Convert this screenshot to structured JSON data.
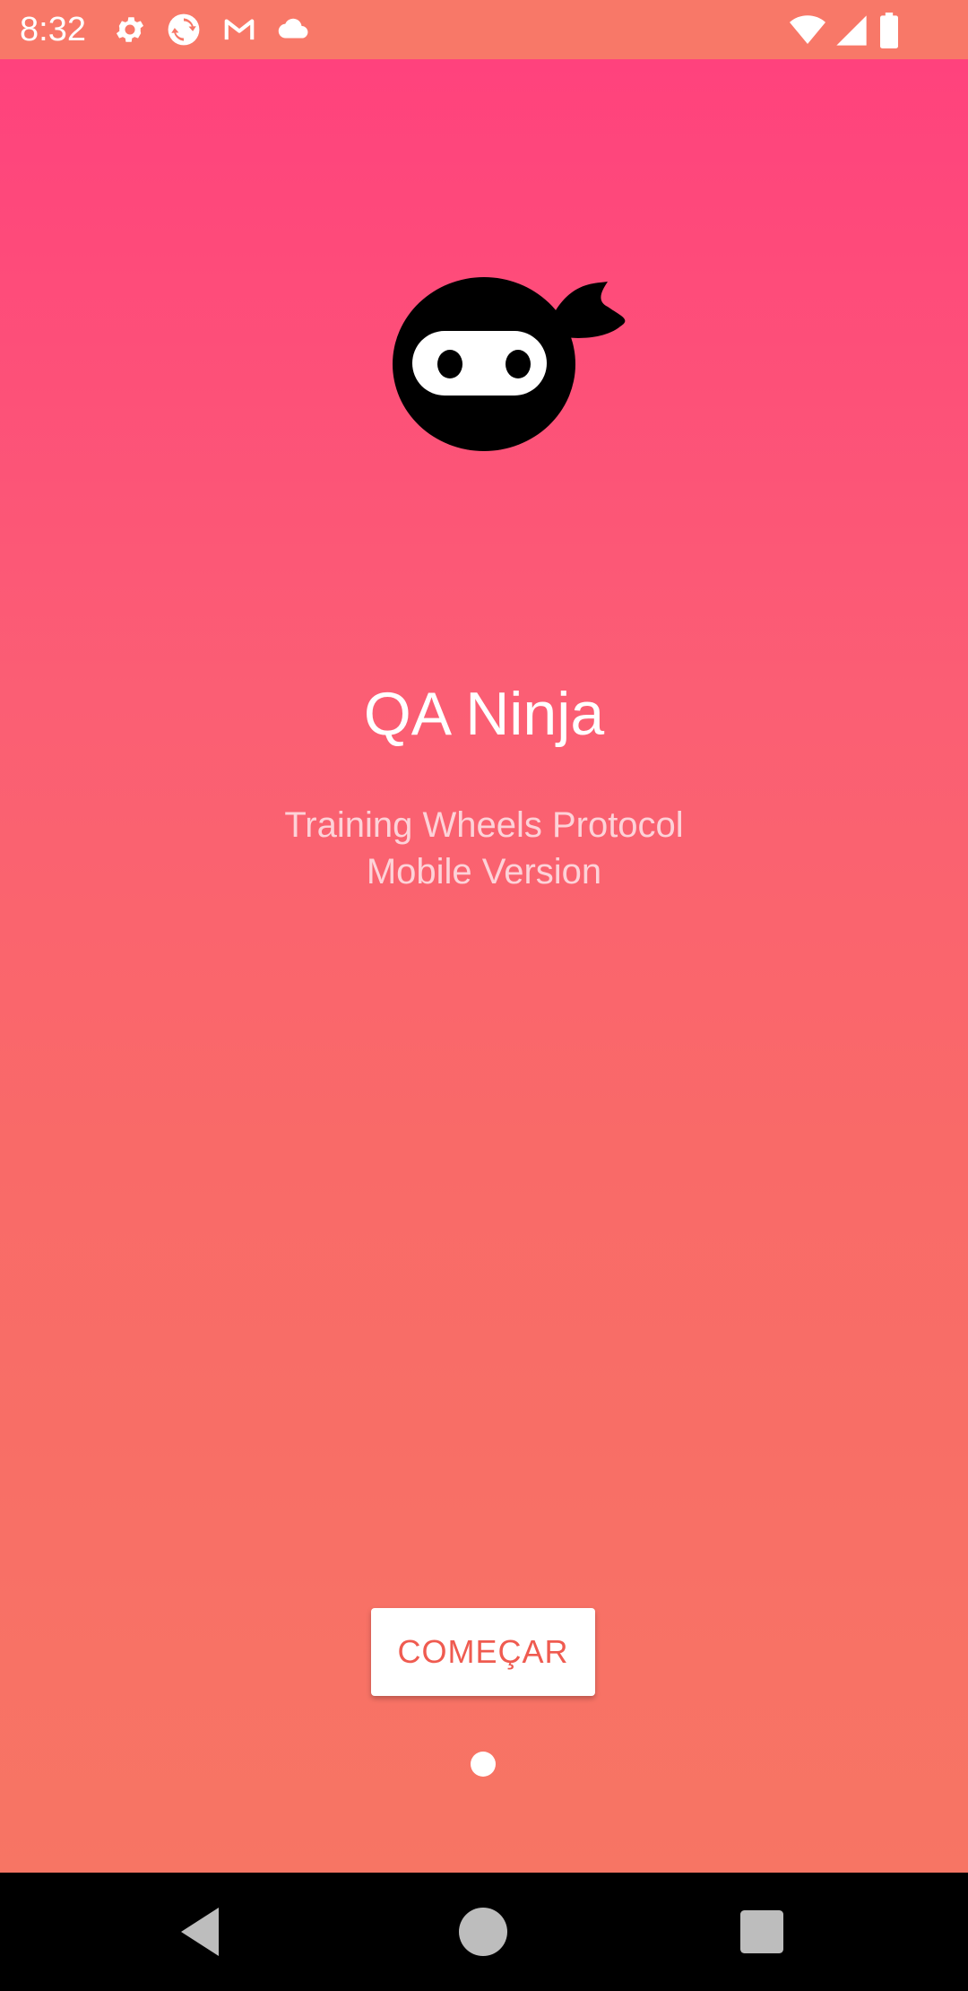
{
  "status_bar": {
    "time": "8:32",
    "icons_left": [
      "gear-icon",
      "sync-icon",
      "gmail-icon",
      "cloud-icon"
    ],
    "icons_right": [
      "wifi-icon",
      "cell-signal-icon",
      "battery-icon"
    ]
  },
  "app": {
    "title": "QA Ninja",
    "subtitle_line1": "Training Wheels Protocol",
    "subtitle_line2": "Mobile Version",
    "logo": "ninja-head-icon"
  },
  "start_button": {
    "label": "COMEÇAR"
  },
  "pager": {
    "current": 1,
    "total": 1
  },
  "nav_bar": {
    "buttons": [
      "back-icon",
      "home-icon",
      "recents-icon"
    ]
  },
  "colors": {
    "gradient_top": "#ff427d",
    "gradient_bottom": "#f77564",
    "button_text": "#ef5b50",
    "subtitle": "#fdd2d8"
  }
}
